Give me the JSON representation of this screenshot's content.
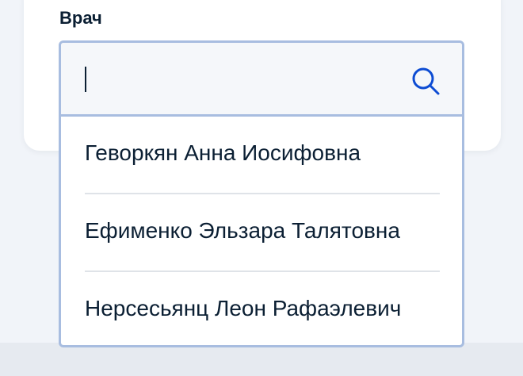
{
  "field": {
    "label": "Врач",
    "search_value": "",
    "search_icon": "search-icon"
  },
  "options": [
    {
      "label": "Геворкян Анна Иосифовна"
    },
    {
      "label": "Ефименко Эльзара Талятовна"
    },
    {
      "label": "Нерсесьянц Леон Рафаэлевич"
    }
  ],
  "colors": {
    "border": "#a8bde0",
    "text": "#0b1f33",
    "icon": "#0d4cd3",
    "background": "#f1f4f9"
  }
}
